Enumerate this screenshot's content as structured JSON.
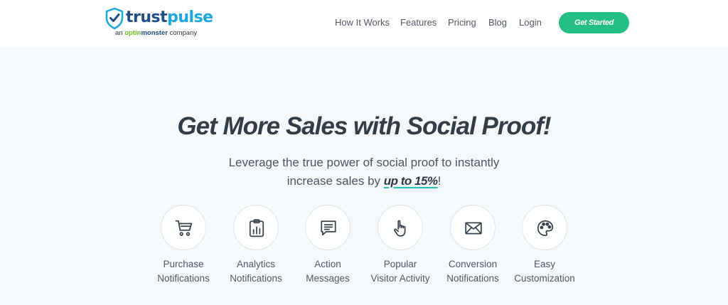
{
  "brand": {
    "name_part1": "trust",
    "name_part2": "pulse",
    "tagline_pre": "an",
    "tagline_brand1": "optin",
    "tagline_brand2": "monster",
    "tagline_post": "company"
  },
  "nav": {
    "links": [
      "How It Works",
      "Features",
      "Pricing",
      "Blog",
      "Login"
    ],
    "cta_label": "Get Started"
  },
  "hero": {
    "headline": "Get More Sales with Social Proof!",
    "subtitle_line1": "Leverage the true power of social proof to instantly",
    "subtitle_line2_pre": "increase sales by",
    "subtitle_highlight": "up to 15%",
    "subtitle_line2_post": "!"
  },
  "features": [
    {
      "line1": "Purchase",
      "line2": "Notifications",
      "icon": "cart-icon"
    },
    {
      "line1": "Analytics",
      "line2": "Notifications",
      "icon": "clipboard-chart-icon"
    },
    {
      "line1": "Action",
      "line2": "Messages",
      "icon": "message-icon"
    },
    {
      "line1": "Popular",
      "line2": "Visitor Activity",
      "icon": "pointer-hand-icon"
    },
    {
      "line1": "Conversion",
      "line2": "Notifications",
      "icon": "envelope-icon"
    },
    {
      "line1": "Easy",
      "line2": "Customization",
      "icon": "palette-icon"
    }
  ],
  "colors": {
    "brand_dark": "#1f4e88",
    "brand_light": "#1aa8e0",
    "cta_green": "#22c086",
    "hero_bg": "#f6f9fc"
  }
}
